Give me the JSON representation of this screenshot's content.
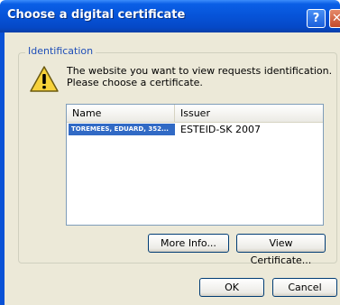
{
  "window": {
    "title": "Choose a digital certificate"
  },
  "titlebar_buttons": {
    "help": "?"
  },
  "group": {
    "label": "Identification"
  },
  "message": {
    "line1": "The website you want to view requests identification.",
    "line2": "Please choose a certificate."
  },
  "list": {
    "columns": [
      "Name",
      "Issuer"
    ],
    "rows": [
      {
        "name": "TOREMEES, EDUARD, 352...",
        "issuer": "ESTEID-SK 2007",
        "selected": true
      }
    ]
  },
  "buttons": {
    "more_info": "More Info...",
    "view_certificate": "View Certificate...",
    "ok": "OK",
    "cancel": "Cancel"
  },
  "colors": {
    "titlebar": "#0653d8",
    "dialog_bg": "#ece9d8",
    "selection": "#316ac5",
    "group_label": "#1f4fb8"
  },
  "icons": {
    "warning": "warning-icon"
  }
}
